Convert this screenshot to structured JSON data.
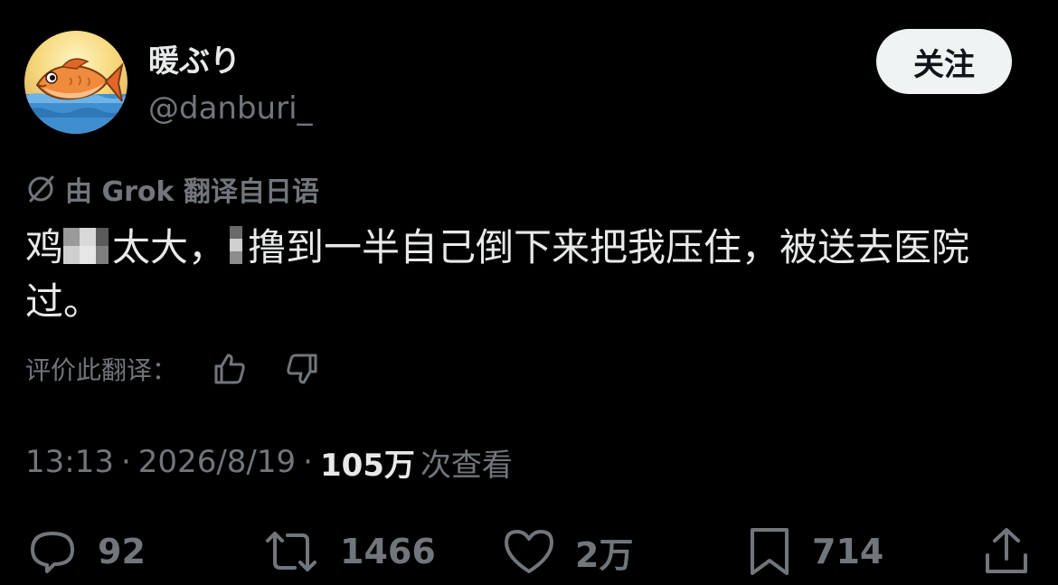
{
  "user": {
    "display_name": "暖ぶり",
    "handle": "@danburi_"
  },
  "follow_label": "关注",
  "translation": {
    "label": "由 Grok 翻译自日语"
  },
  "tweet": {
    "text_part1": "鸡",
    "text_part2": "太大，",
    "text_part3": "撸到一半自己倒下来把我压住，被送去医院过。"
  },
  "rate": {
    "label": "评价此翻译："
  },
  "meta": {
    "time": "13:13",
    "date": "2026/8/19",
    "views_count": "105万",
    "views_label": "次查看",
    "separator": "·"
  },
  "actions": {
    "replies": "92",
    "reposts": "1466",
    "likes": "2万",
    "bookmarks": "714"
  },
  "colors": {
    "background": "#000000",
    "text_primary": "#e7e9ea",
    "text_secondary": "#71767b",
    "follow_bg": "#eff3f4"
  },
  "icons": {
    "translate": "no-translate-icon",
    "thumbs_up": "thumbs-up-icon",
    "thumbs_down": "thumbs-down-icon",
    "reply": "reply-icon",
    "repost": "repost-icon",
    "like": "heart-icon",
    "bookmark": "bookmark-icon",
    "share": "share-icon"
  }
}
